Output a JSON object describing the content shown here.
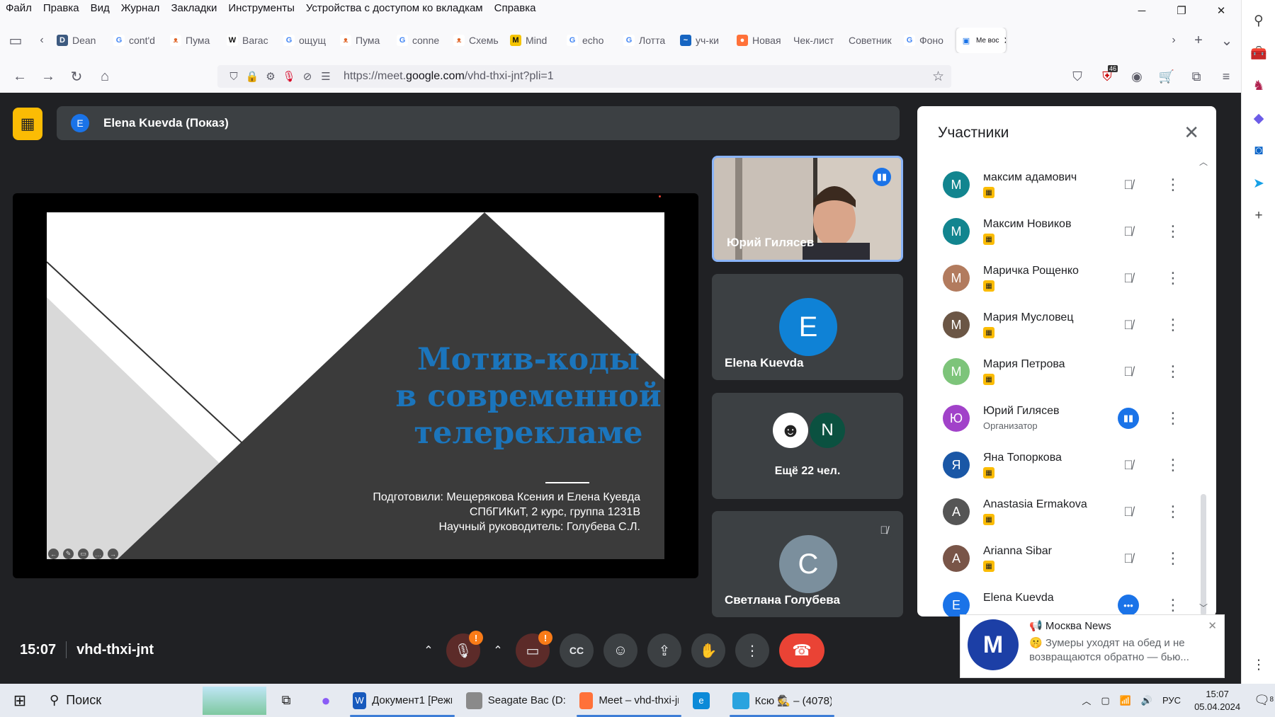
{
  "browser": {
    "menu": [
      "Файл",
      "Правка",
      "Вид",
      "Журнал",
      "Закладки",
      "Инструменты",
      "Устройства с доступом ко вкладкам",
      "Справка"
    ],
    "tabs": [
      {
        "label": "Dean",
        "icon": "d"
      },
      {
        "label": "cont'd",
        "icon": "google"
      },
      {
        "label": "Пума",
        "icon": "puma"
      },
      {
        "label": "Barac",
        "icon": "wiki"
      },
      {
        "label": "ощущ",
        "icon": "google"
      },
      {
        "label": "Пума",
        "icon": "puma"
      },
      {
        "label": "conne",
        "icon": "google"
      },
      {
        "label": "Схемь",
        "icon": "puma"
      },
      {
        "label": "Mind",
        "icon": "mind"
      },
      {
        "label": "echo",
        "icon": "google"
      },
      {
        "label": "Лотта",
        "icon": "google"
      },
      {
        "label": "уч-ки",
        "icon": "edge"
      },
      {
        "label": "Новая",
        "icon": "firefox"
      },
      {
        "label": "Чек-лист",
        "icon": "none"
      },
      {
        "label": "Советник",
        "icon": "none"
      },
      {
        "label": "Фоно",
        "icon": "google"
      },
      {
        "label": "Me вос",
        "icon": "meet"
      }
    ],
    "url_prefix": "https://meet.",
    "url_domain": "google.com",
    "url_suffix": "/vhd-thxi-jnt?pli=1",
    "ext_badge": "46"
  },
  "presentation": {
    "avatar_letter": "E",
    "presenter": "Elena Kuevda (Показ)"
  },
  "slide": {
    "title_line1": "Мотив-коды",
    "title_line2": "в современной",
    "title_line3": "телерекламе",
    "info_line1": "Подготовили: Мещерякова Ксения и Елена Куевда",
    "info_line2": "СПбГИКиТ, 2 курс, группа 1231В",
    "info_line3": "Научный руководитель: Голубева С.Л."
  },
  "tiles": [
    {
      "name": "Юрий Гилясев"
    },
    {
      "name": "Elena Kuevda",
      "letter": "E",
      "color": "#0f82d6"
    },
    {
      "name": "Ещё 22 чел.",
      "letter": "N",
      "color": "#0b5140"
    },
    {
      "name": "Светлана Голубева",
      "letter": "C",
      "color": "#7b8f9d"
    }
  ],
  "bottom": {
    "time": "15:07",
    "meeting_code": "vhd-thxi-jnt"
  },
  "participants": {
    "title": "Участники",
    "list": [
      {
        "name": "максим адамович",
        "letter": "М",
        "color": "#12858f",
        "badge": true,
        "mic": "muted"
      },
      {
        "name": "Максим Новиков",
        "letter": "М",
        "color": "#12858f",
        "badge": true,
        "mic": "muted"
      },
      {
        "name": "Маричка Рощенко",
        "letter": "М",
        "color": "#b27b5e",
        "badge": true,
        "mic": "muted"
      },
      {
        "name": "Мария Мусловец",
        "letter": "М",
        "color": "#6b5645",
        "badge": true,
        "mic": "muted"
      },
      {
        "name": "Мария Петрова",
        "letter": "М",
        "color": "#7dc47a",
        "badge": true,
        "mic": "muted"
      },
      {
        "name": "Юрий Гилясев",
        "letter": "Ю",
        "color": "#a142c9",
        "sub": "Организатор",
        "mic": "speaking"
      },
      {
        "name": "Яна Топоркова",
        "letter": "Я",
        "color": "#1a57a6",
        "badge": true,
        "mic": "muted"
      },
      {
        "name": "Anastasia Ermakova",
        "letter": "A",
        "color": "#555555",
        "badge": true,
        "mic": "muted"
      },
      {
        "name": "Arianna Sibar",
        "letter": "A",
        "color": "#795548",
        "badge": true,
        "mic": "muted"
      },
      {
        "name": "Elena Kuevda",
        "letter": "E",
        "color": "#1a73e8",
        "badge": false,
        "mic": "more"
      }
    ]
  },
  "notification": {
    "title": "📢 Москва News",
    "text": "🤫 Зумеры уходят на обед и не возвращаются обратно — бью..."
  },
  "taskbar": {
    "search": "Поиск",
    "apps": [
      {
        "label": "Документ1 [Режим...",
        "color": "#185abd",
        "icon": "W"
      },
      {
        "label": "Seagate Bac (D:)",
        "color": "#8a8a8a",
        "icon": ""
      },
      {
        "label": "Meet – vhd-thxi-jnt ...",
        "color": "#ff7139",
        "icon": ""
      },
      {
        "label": "",
        "color": "#0c8ad8",
        "icon": "e"
      },
      {
        "label": "Ксю 🕵️ – (4078)",
        "color": "#2aa3df",
        "icon": ""
      }
    ],
    "lang": "РУС",
    "time": "15:07",
    "date": "05.04.2024",
    "notif_count": "8"
  }
}
